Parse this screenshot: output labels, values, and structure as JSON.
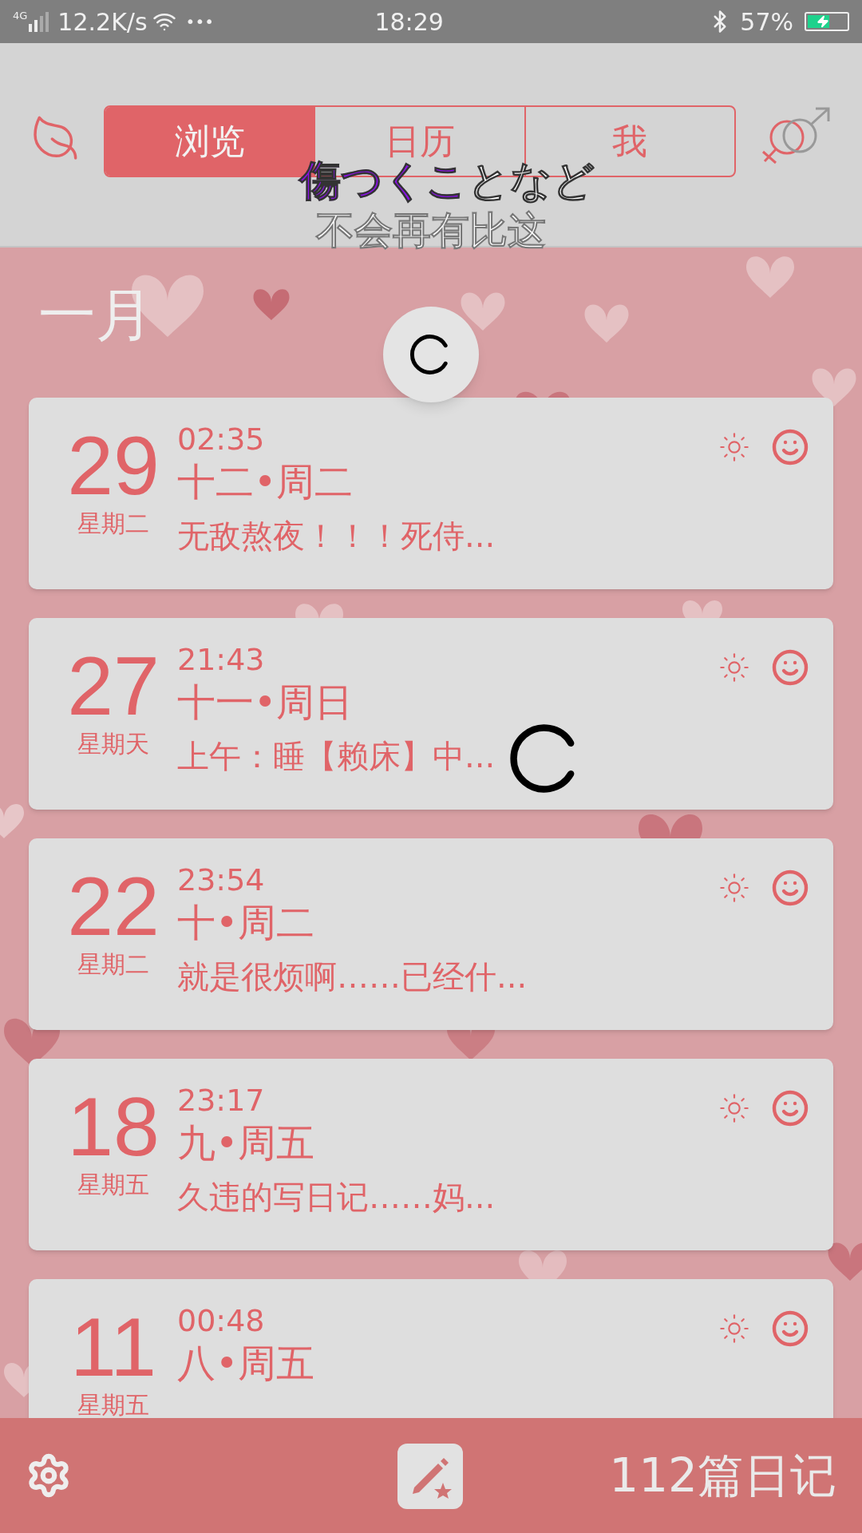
{
  "status_bar": {
    "network": "4G",
    "speed": "12.2K/s",
    "more": "•••",
    "time": "18:29",
    "battery": "57%"
  },
  "tabs": [
    {
      "label": "浏览",
      "selected": true
    },
    {
      "label": "日历",
      "selected": false
    },
    {
      "label": "我",
      "selected": false
    }
  ],
  "lyrics": {
    "line_1": [
      {
        "text": "傷つくこ",
        "sung": true
      },
      {
        "text": "となど",
        "sung": false
      }
    ],
    "line_2": "不会再有比这"
  },
  "month": "一月",
  "entries": [
    {
      "day": "29",
      "weekday": "星期二",
      "time": "02:35",
      "lunar": "十二•周二",
      "excerpt": "无敌熬夜！！！死侍..."
    },
    {
      "day": "27",
      "weekday": "星期天",
      "time": "21:43",
      "lunar": "十一•周日",
      "excerpt": "上午：睡【赖床】中..."
    },
    {
      "day": "22",
      "weekday": "星期二",
      "time": "23:54",
      "lunar": "十•周二",
      "excerpt": "就是很烦啊……已经什..."
    },
    {
      "day": "18",
      "weekday": "星期五",
      "time": "23:17",
      "lunar": "九•周五",
      "excerpt": "久违的写日记……妈..."
    },
    {
      "day": "11",
      "weekday": "星期五",
      "time": "00:48",
      "lunar": "八•周五"
    }
  ],
  "footer": {
    "count": "112篇日记"
  }
}
